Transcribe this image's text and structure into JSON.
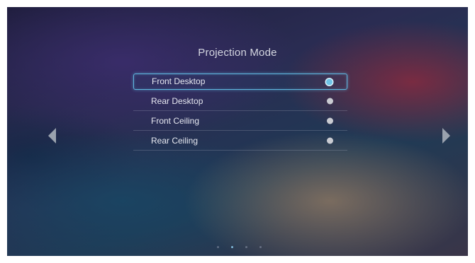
{
  "page": {
    "title": "Projection Mode"
  },
  "menu": {
    "options": [
      {
        "label": "Front Desktop",
        "selected": true
      },
      {
        "label": "Rear Desktop",
        "selected": false
      },
      {
        "label": "Front Ceiling",
        "selected": false
      },
      {
        "label": "Rear Ceiling",
        "selected": false
      }
    ]
  },
  "navigation": {
    "prev_icon": "triangle-left-icon",
    "next_icon": "triangle-right-icon"
  },
  "pager": {
    "page_count": 4,
    "active_index": 1
  },
  "colors": {
    "accent": "#5fb8e0",
    "text": "#e6e8f0",
    "radio_unselected": "#c9cbd2"
  }
}
